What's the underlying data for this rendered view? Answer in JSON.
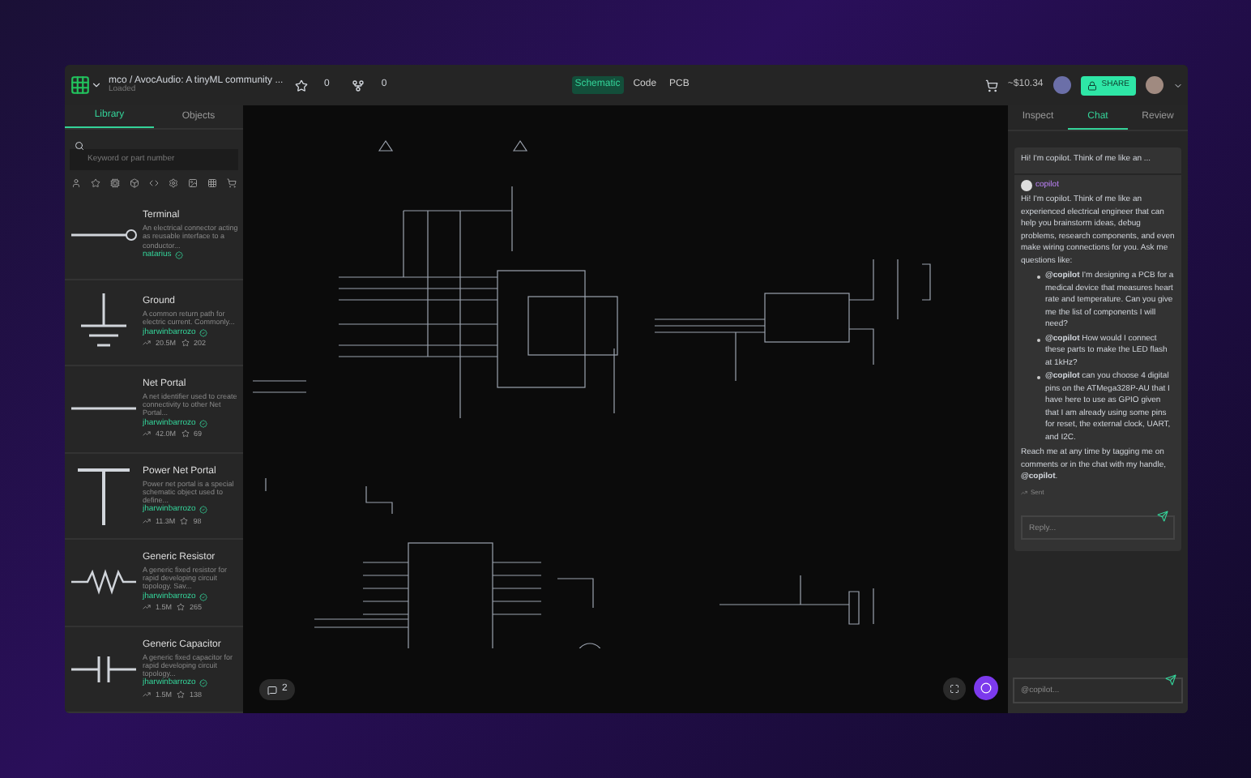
{
  "header": {
    "breadcrumb": "mco / AvocAudio: A tinyML community ...",
    "status": "Loaded",
    "stars": "0",
    "forks": "0",
    "view_tabs": [
      {
        "label": "Schematic",
        "selected": true
      },
      {
        "label": "Code",
        "selected": false
      },
      {
        "label": "PCB",
        "selected": false
      }
    ],
    "balance": "~$10.34",
    "share": "SHARE"
  },
  "left_tabs": [
    {
      "label": "Library",
      "selected": true
    },
    {
      "label": "Objects",
      "selected": false
    }
  ],
  "search": {
    "placeholder": "Keyword or part number"
  },
  "parts": [
    {
      "name": "Terminal",
      "description": "An electrical connector acting as reusable interface to a conductor...",
      "author": "natarius",
      "kind": "terminal"
    },
    {
      "name": "Ground",
      "description": "A common return path for electric current. Commonly...",
      "author": "jharwinbarrozo",
      "downloads": "20.5M",
      "stars": "202",
      "kind": "ground"
    },
    {
      "name": "Net Portal",
      "description": "A net identifier used to create connectivity to other Net Portal...",
      "author": "jharwinbarrozo",
      "downloads": "42.0M",
      "stars": "69",
      "kind": "net"
    },
    {
      "name": "Power Net Portal",
      "description": "Power net portal is a special schematic object used to define...",
      "author": "jharwinbarrozo",
      "downloads": "11.3M",
      "stars": "98",
      "kind": "power"
    },
    {
      "name": "Generic Resistor",
      "description": "A generic fixed resistor for rapid developing circuit topology. Sav...",
      "author": "jharwinbarrozo",
      "downloads": "1.5M",
      "stars": "265",
      "kind": "resistor"
    },
    {
      "name": "Generic Capacitor",
      "description": "A generic fixed capacitor for rapid developing circuit topology...",
      "author": "jharwinbarrozo",
      "downloads": "1.5M",
      "stars": "138",
      "kind": "capacitor"
    }
  ],
  "canvas": {
    "comments": "2"
  },
  "right_tabs": [
    {
      "label": "Inspect",
      "selected": false
    },
    {
      "label": "Chat",
      "selected": true
    },
    {
      "label": "Review",
      "selected": false
    }
  ],
  "chat": {
    "prompt": "Hi! I'm copilot. Think of me like an ...",
    "author": "copilot",
    "intro": "Hi! I'm copilot. Think of me like an experienced electrical engineer that can help you brainstorm ideas, debug problems, research components, and even make wiring connections for you. Ask me questions like:",
    "examples": [
      "**@copilot** I'm designing a PCB for a medical device that measures heart rate and temperature. Can you give me the list of components I will need?",
      "**@copilot** How would I connect these parts to make the LED flash at 1kHz?",
      "**@copilot** can you choose 4 digital pins on the ATMega328P-AU that I have here to use as GPIO given that I am already using some pins for reset, the external clock, UART, and I2C."
    ],
    "outro": "Reach me at any time by tagging me on comments or in the chat with my handle, **@copilot**.",
    "reaction": "Sent",
    "reply_placeholder": "Reply...",
    "input_placeholder": "@copilot..."
  }
}
